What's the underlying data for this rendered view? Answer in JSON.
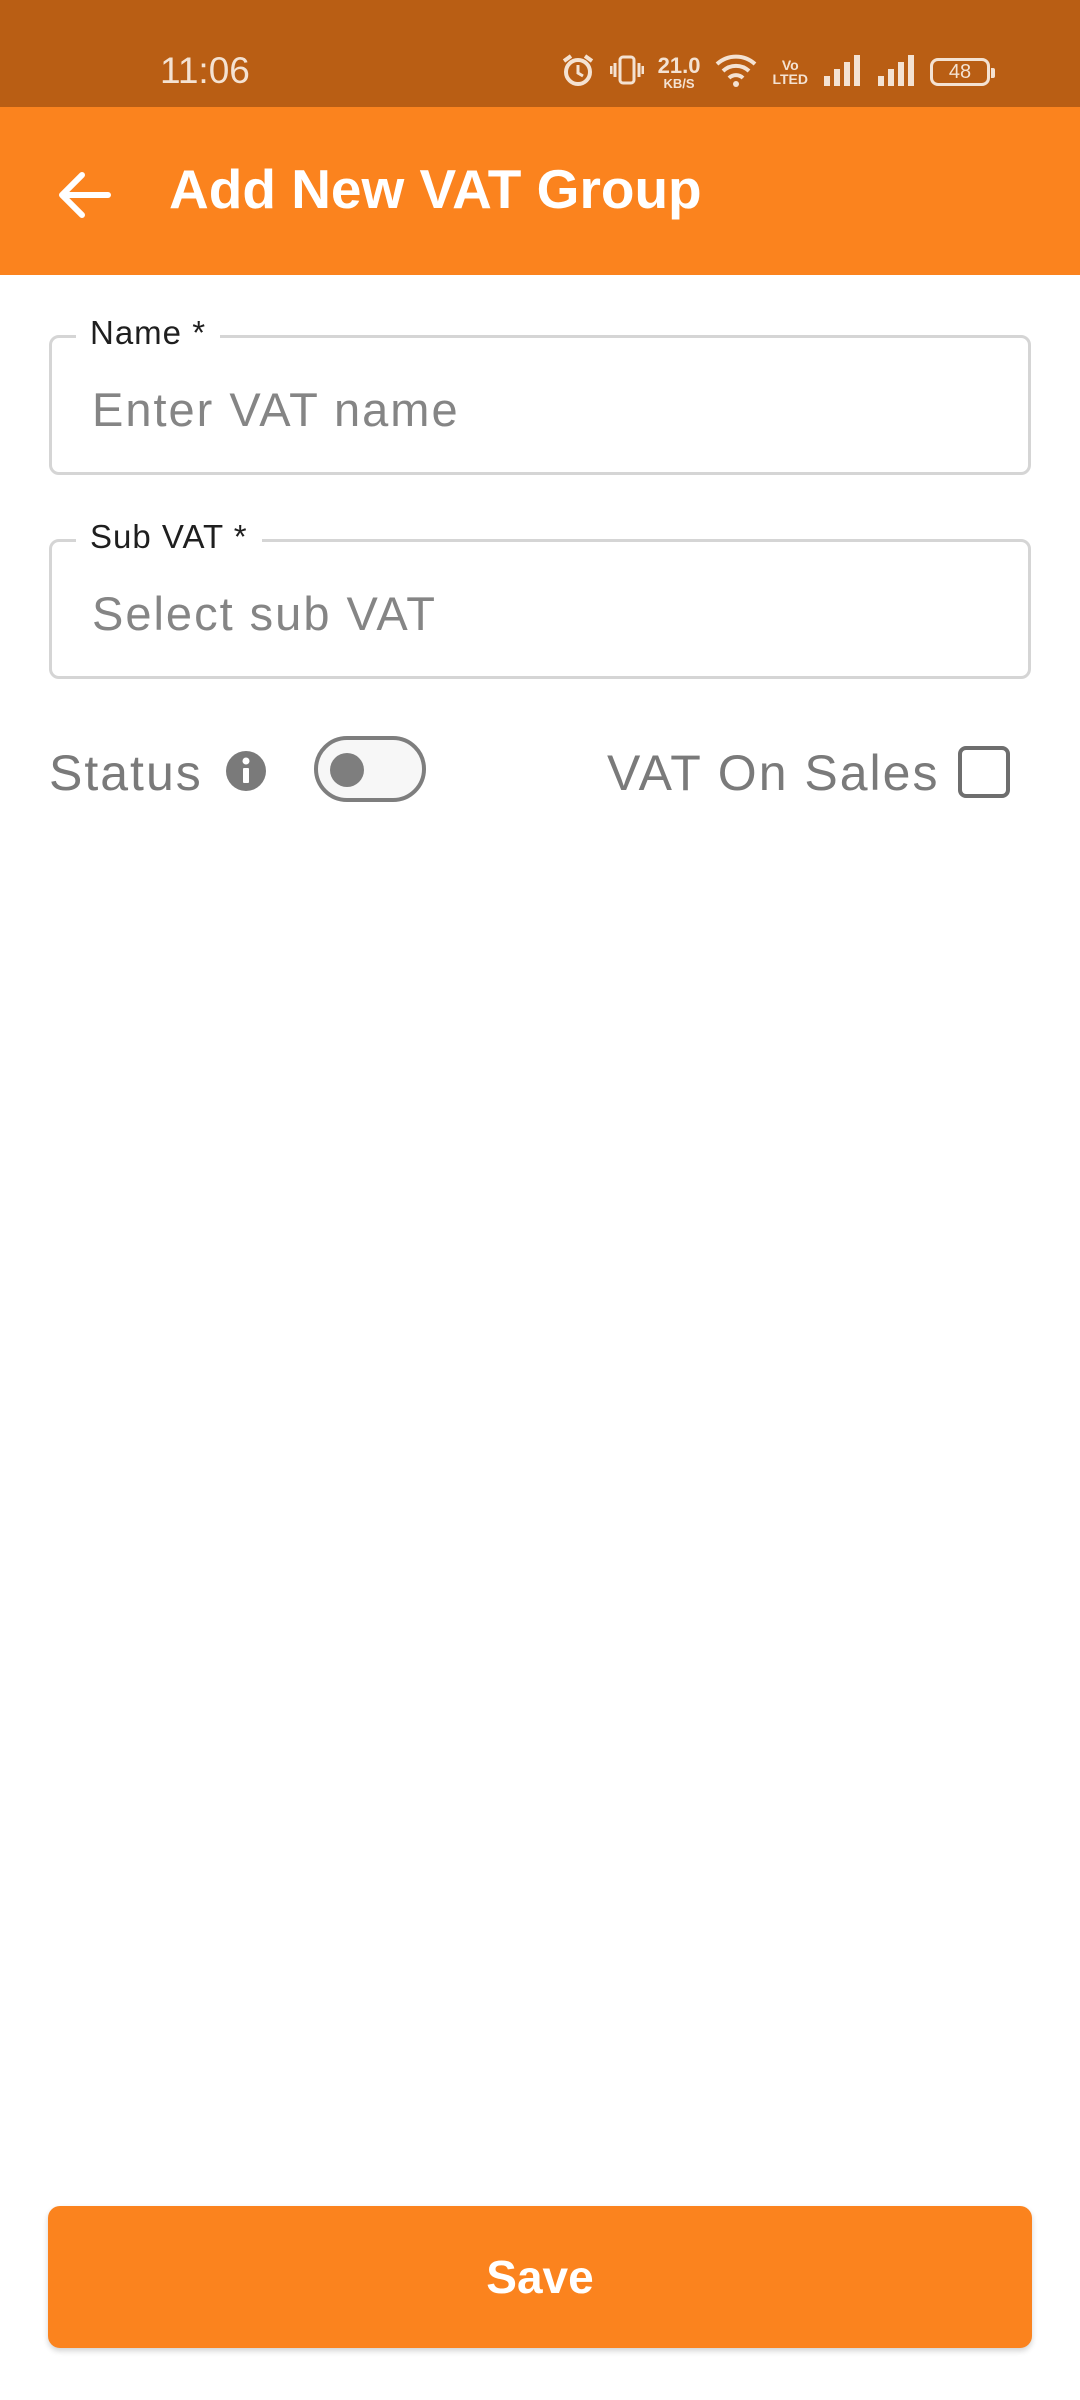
{
  "status_bar": {
    "time": "11:06",
    "net_speed_value": "21.0",
    "net_speed_unit": "KB/S",
    "volte_top": "Vo",
    "volte_bottom": "LTED",
    "battery": "48",
    "icons": [
      "alarm-icon",
      "vibrate-icon",
      "wifi-icon",
      "volte-icon",
      "signal-icon",
      "signal-icon",
      "battery-icon"
    ]
  },
  "app_bar": {
    "title": "Add New VAT Group",
    "back_icon": "arrow-left-icon",
    "background": "#FB831E"
  },
  "form": {
    "name": {
      "label": "Name *",
      "placeholder": "Enter VAT name"
    },
    "sub_vat": {
      "label": "Sub VAT *",
      "placeholder": "Select sub VAT"
    },
    "status": {
      "label": "Status",
      "info_icon": "info-icon",
      "enabled": false
    },
    "vat_on_sales": {
      "label": "VAT On Sales",
      "checked": false
    }
  },
  "actions": {
    "save_label": "Save"
  },
  "colors": {
    "status_bar": "#B95E14",
    "accent": "#FB831E",
    "muted_text": "#7A7A7A"
  }
}
